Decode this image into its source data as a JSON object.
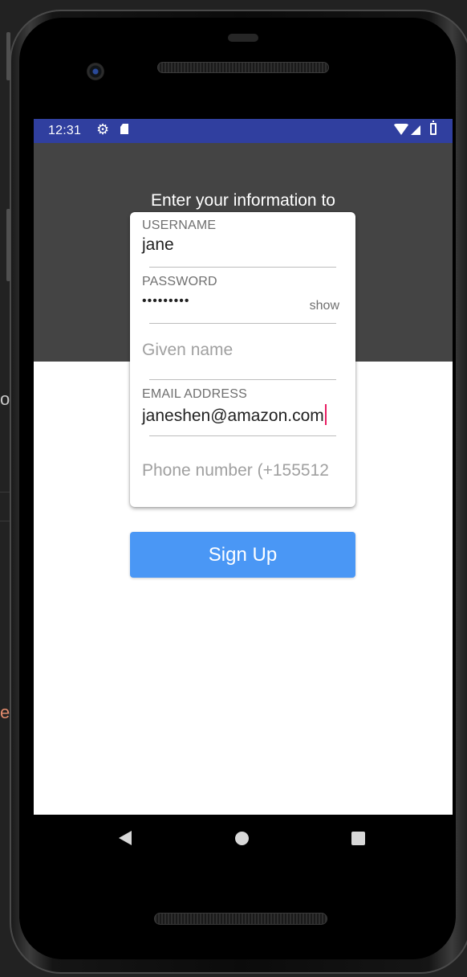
{
  "background": {
    "fragment_top": "or",
    "fragment_bottom": "ex",
    "fragment_bottom_color": "#e08a6c"
  },
  "status_bar": {
    "time": "12:31",
    "color": "#303f9f"
  },
  "header": {
    "title": "Enter your information to"
  },
  "form": {
    "username": {
      "label": "USERNAME",
      "value": "jane"
    },
    "password": {
      "label": "PASSWORD",
      "masked_value": "•••••••••",
      "toggle_label": "show"
    },
    "given_name": {
      "placeholder": "Given name"
    },
    "email": {
      "label": "EMAIL ADDRESS",
      "value": "janeshen@amazon.com"
    },
    "phone": {
      "placeholder": "Phone number (+155512"
    }
  },
  "actions": {
    "signup_label": "Sign Up",
    "signup_color": "#4a97f5"
  },
  "icons": {
    "status": [
      "gear-icon",
      "sd-card-icon",
      "wifi-icon",
      "signal-icon",
      "battery-icon"
    ],
    "nav": [
      "back-icon",
      "home-icon",
      "recents-icon"
    ]
  }
}
